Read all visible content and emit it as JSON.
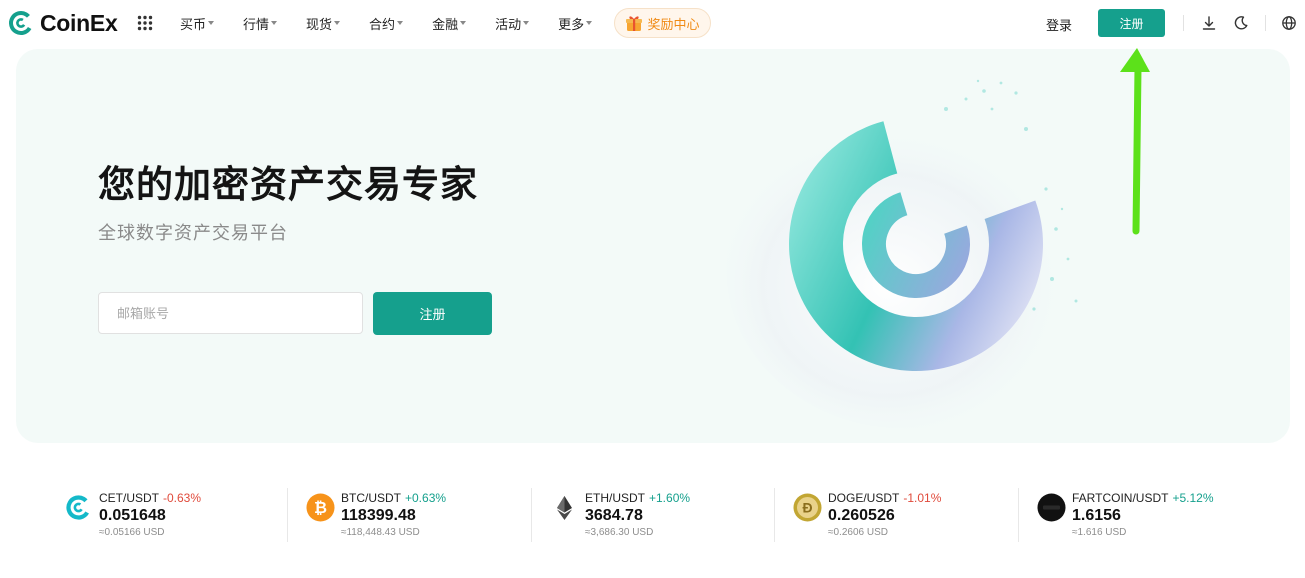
{
  "header": {
    "brand": "CoinEx",
    "nav": [
      {
        "label": "买币"
      },
      {
        "label": "行情"
      },
      {
        "label": "现货"
      },
      {
        "label": "合约"
      },
      {
        "label": "金融"
      },
      {
        "label": "活动"
      },
      {
        "label": "更多"
      }
    ],
    "rewards_label": "奖励中心",
    "login_label": "登录",
    "register_label": "注册"
  },
  "hero": {
    "title": "您的加密资产交易专家",
    "subtitle": "全球数字资产交易平台",
    "email_placeholder": "邮箱账号",
    "register_label": "注册"
  },
  "tickers": [
    {
      "pair": "CET/USDT",
      "change": "-0.63%",
      "direction": "down",
      "price": "0.051648",
      "usd": "≈0.05166 USD",
      "icon": "cet-icon"
    },
    {
      "pair": "BTC/USDT",
      "change": "+0.63%",
      "direction": "up",
      "price": "118399.48",
      "usd": "≈118,448.43 USD",
      "icon": "bitcoin-icon"
    },
    {
      "pair": "ETH/USDT",
      "change": "+1.60%",
      "direction": "up",
      "price": "3684.78",
      "usd": "≈3,686.30 USD",
      "icon": "ethereum-icon"
    },
    {
      "pair": "DOGE/USDT",
      "change": "-1.01%",
      "direction": "down",
      "price": "0.260526",
      "usd": "≈0.2606 USD",
      "icon": "dogecoin-icon"
    },
    {
      "pair": "FARTCOIN/USDT",
      "change": "+5.12%",
      "direction": "up",
      "price": "1.6156",
      "usd": "≈1.616 USD",
      "icon": "fartcoin-icon"
    }
  ],
  "colors": {
    "brand": "#15a08d",
    "up": "#15a08d",
    "down": "#e04a3b",
    "hero_bg": "#f3faf8",
    "rewards": "#f08a13",
    "annotation_arrow": "#5ce11a"
  },
  "icons": [
    "coinex-logo-icon",
    "apps-grid-icon",
    "gift-icon",
    "download-icon",
    "moon-icon",
    "globe-icon"
  ]
}
